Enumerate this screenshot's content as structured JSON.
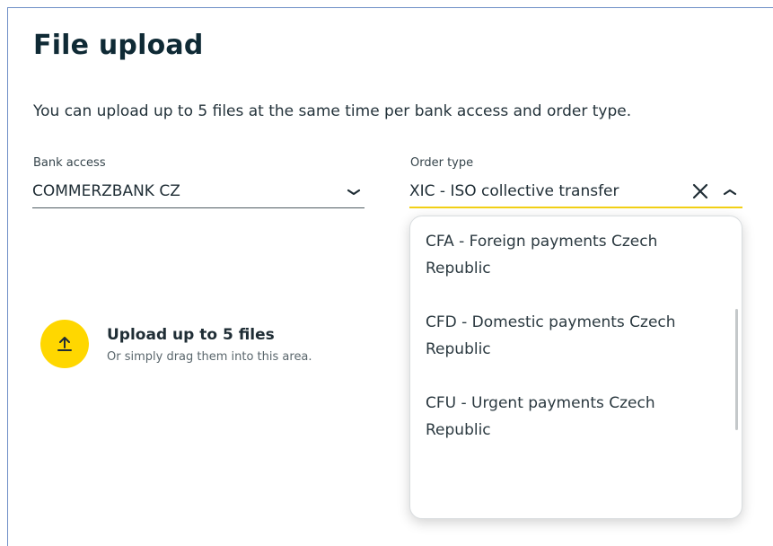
{
  "page": {
    "title": "File upload",
    "subtitle": "You can upload up to 5 files at the same time per bank access and order type."
  },
  "bank_access": {
    "label": "Bank access",
    "value": "COMMERZBANK CZ"
  },
  "order_type": {
    "label": "Order type",
    "value": "XIC - ISO collective transfer",
    "options": [
      {
        "label": "CFA - Foreign payments Czech Republic"
      },
      {
        "label": "CFD - Domestic payments Czech Republic"
      },
      {
        "label": "CFU - Urgent payments Czech Republic"
      }
    ]
  },
  "upload": {
    "title": "Upload up to 5 files",
    "hint": "Or simply drag them into this area."
  },
  "colors": {
    "accent": "#ffd700",
    "title_text": "#0f2a35"
  },
  "icons": {
    "bank_access_chevron": "chevron-down-icon",
    "order_type_clear": "close-icon",
    "order_type_chevron": "chevron-up-icon",
    "upload": "upload-icon"
  }
}
